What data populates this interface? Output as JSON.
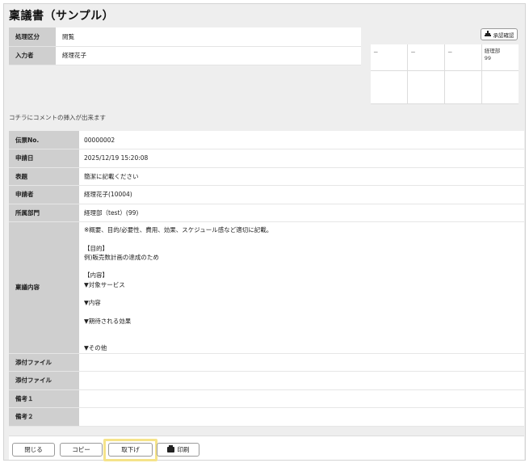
{
  "page": {
    "title": "稟議書（サンプル）"
  },
  "info": [
    {
      "label": "処理区分",
      "value": "閲覧"
    },
    {
      "label": "入力者",
      "value": "経理花子"
    }
  ],
  "stamp_button": {
    "label": "承認確認"
  },
  "approval": {
    "cells": [
      "－",
      "－",
      "－",
      "経理部\n99"
    ]
  },
  "comment": "コチラにコメントの挿入が出来ます",
  "details": {
    "voucher_no": {
      "label": "伝票No.",
      "value": "00000002"
    },
    "apply_date": {
      "label": "申請日",
      "value": "2025/12/19 15:20:08"
    },
    "subject": {
      "label": "表題",
      "value": "簡潔に記載ください"
    },
    "applicant": {
      "label": "申請者",
      "value": "経理花子(10004)"
    },
    "department": {
      "label": "所属部門",
      "value": "経理部（test）(99)"
    },
    "content": {
      "label": "稟議内容",
      "value": "※概要、目的/必要性、費用、効果、スケジュール感など適切に記載。\n\n【目的】\n例)販売数計画の達成のため\n\n【内容】\n▼対象サービス\n\n▼内容\n\n▼期待される効果\n\n\n▼その他"
    },
    "attachment1": {
      "label": "添付ファイル",
      "value": ""
    },
    "attachment2": {
      "label": "添付ファイル",
      "value": ""
    },
    "note1": {
      "label": "備考１",
      "value": ""
    },
    "note2": {
      "label": "備考２",
      "value": ""
    }
  },
  "buttons": {
    "close": "閉じる",
    "copy": "コピー",
    "withdraw": "取下げ",
    "print": "印刷"
  },
  "icons": {
    "stamp": "stamp-icon",
    "print": "printer-icon"
  }
}
